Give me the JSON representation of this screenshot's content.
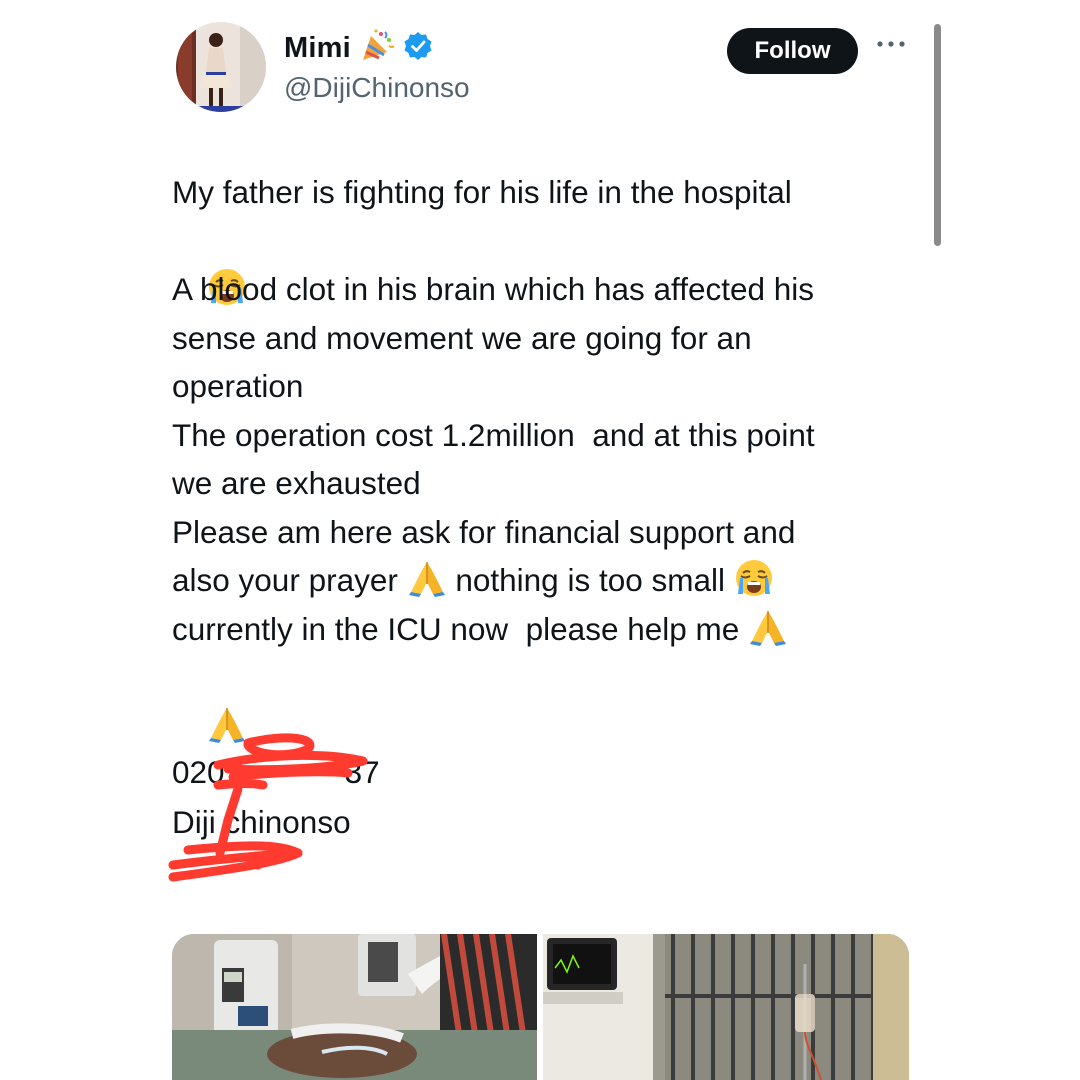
{
  "profile": {
    "name": "Mimi",
    "handle": "@DijiChinonso",
    "name_emoji": "party-popper-icon",
    "verified_icon": "verified-badge-icon",
    "verified_color": "#1d9bf0"
  },
  "header": {
    "follow_label": "Follow",
    "more_icon": "more-horizontal-icon"
  },
  "tweet": {
    "lines": [
      "My father is fighting for his life in the hospital",
      "",
      "A blood clot in his brain which has affected his",
      "sense and movement we are going for an",
      "operation",
      "The operation cost 1.2million  and at this point",
      "we are exhausted",
      "Please am here ask for financial support and",
      "also your prayer ",
      " nothing is too small ",
      "currently in the ICU now  please help me ",
      ""
    ],
    "emojis": {
      "crying": "loudly-crying-face-icon",
      "praying": "folded-hands-icon"
    }
  },
  "bank_details": {
    "account_number_visible": "020",
    "account_number_end": "37",
    "account_name": "Diji chinonso",
    "redaction_color": "#ff3b30"
  },
  "media": {
    "images": [
      {
        "name": "hospital-bed-photo"
      },
      {
        "name": "hospital-room-photo"
      }
    ]
  },
  "colors": {
    "text": "#0f1419",
    "secondary": "#536471",
    "follow_bg": "#0f1419",
    "follow_text": "#ffffff"
  }
}
